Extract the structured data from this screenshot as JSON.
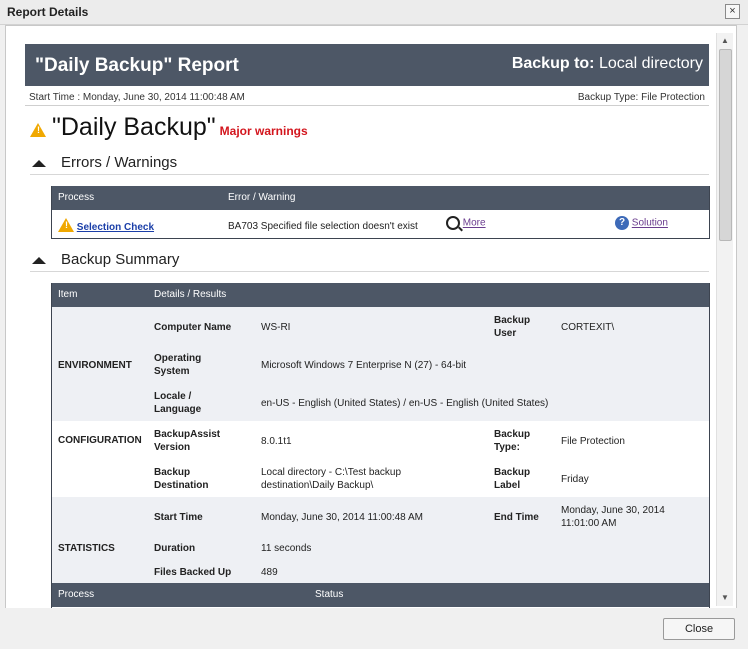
{
  "window": {
    "title": "Report Details",
    "close_glyph": "×"
  },
  "report": {
    "header_title": "\"Daily Backup\" Report",
    "backup_to_label": "Backup to:",
    "backup_to_value": "Local directory",
    "start_time": "Start Time :  Monday, June 30, 2014 11:00:48 AM",
    "backup_type": "Backup Type: File Protection",
    "main_title": "\"Daily Backup\"",
    "status": "Major warnings",
    "status_icon": "warning-icon"
  },
  "errors_section": {
    "title": "Errors / Warnings",
    "columns": [
      "Process",
      "Error  /  Warning"
    ],
    "row": {
      "process": "Selection Check",
      "message": "BA703 Specified file selection doesn't exist",
      "more": "More",
      "solution": "Solution"
    }
  },
  "summary_section": {
    "title": "Backup Summary",
    "columns": [
      "Item",
      "Details  /  Results"
    ],
    "groups": {
      "environment": "ENVIRONMENT",
      "configuration": "CONFIGURATION",
      "statistics": "STATISTICS"
    },
    "fields": {
      "computer_name_label": "Computer Name",
      "computer_name": "WS-RI",
      "backup_user_label1": "Backup",
      "backup_user_label2": "User",
      "backup_user": "CORTEXIT\\",
      "os_label1": "Operating",
      "os_label2": "System",
      "os": "Microsoft Windows 7 Enterprise N (27) - 64-bit",
      "locale_label1": "Locale /",
      "locale_label2": "Language",
      "locale": "en-US - English (United States) / en-US - English (United States)",
      "version_label1": "BackupAssist",
      "version_label2": "Version",
      "version": "8.0.1t1",
      "backup_type_label1": "Backup",
      "backup_type_label2": "Type:",
      "backup_type": "File Protection",
      "destination_label1": "Backup",
      "destination_label2": "Destination",
      "destination_line1": "Local directory - C:\\Test backup",
      "destination_line2": "destination\\Daily Backup\\",
      "backup_label_label1": "Backup",
      "backup_label_label2": "Label",
      "backup_label": "Friday",
      "start_time_label": "Start Time",
      "start_time": "Monday, June 30, 2014 11:00:48 AM",
      "end_time_label": "End Time",
      "end_time_line1": "Monday, June 30, 2014",
      "end_time_line2": "11:01:00 AM",
      "duration_label": "Duration",
      "duration": "11 seconds",
      "files_label": "Files Backed Up",
      "files": "489"
    },
    "process_columns": [
      "Process",
      "Status"
    ]
  },
  "footer": {
    "close_button": "Close"
  }
}
